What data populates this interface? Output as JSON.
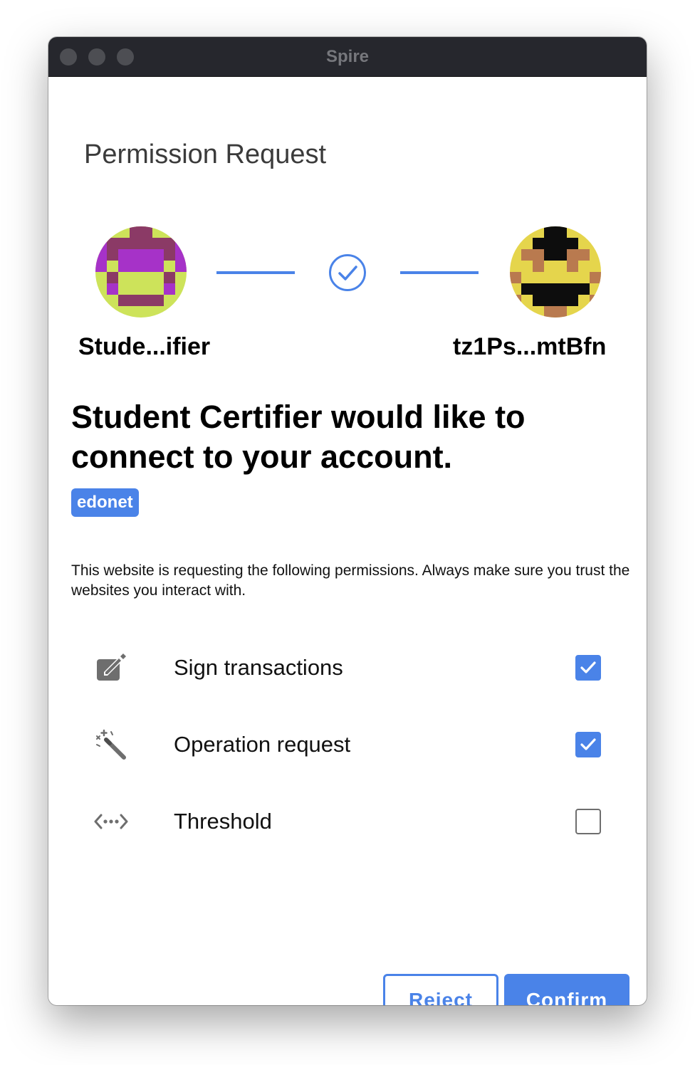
{
  "window": {
    "title": "Spire"
  },
  "page": {
    "title": "Permission Request"
  },
  "connection": {
    "dapp_name": "Stude...ifier",
    "account_name": "tz1Ps...mtBfn"
  },
  "headline": "Student Certifier would like to connect to your account.",
  "network": "edonet",
  "notice": "This website is requesting the following permissions. Always make sure you trust the websites you interact with.",
  "permissions": [
    {
      "label": "Sign transactions",
      "icon": "edit-icon",
      "checked": true
    },
    {
      "label": "Operation request",
      "icon": "magic-wand-icon",
      "checked": true
    },
    {
      "label": "Threshold",
      "icon": "code-arrows-icon",
      "checked": false
    }
  ],
  "buttons": {
    "reject": "Reject",
    "confirm": "Confirm"
  },
  "colors": {
    "accent": "#4a83e8",
    "titlebar": "#26272d"
  }
}
